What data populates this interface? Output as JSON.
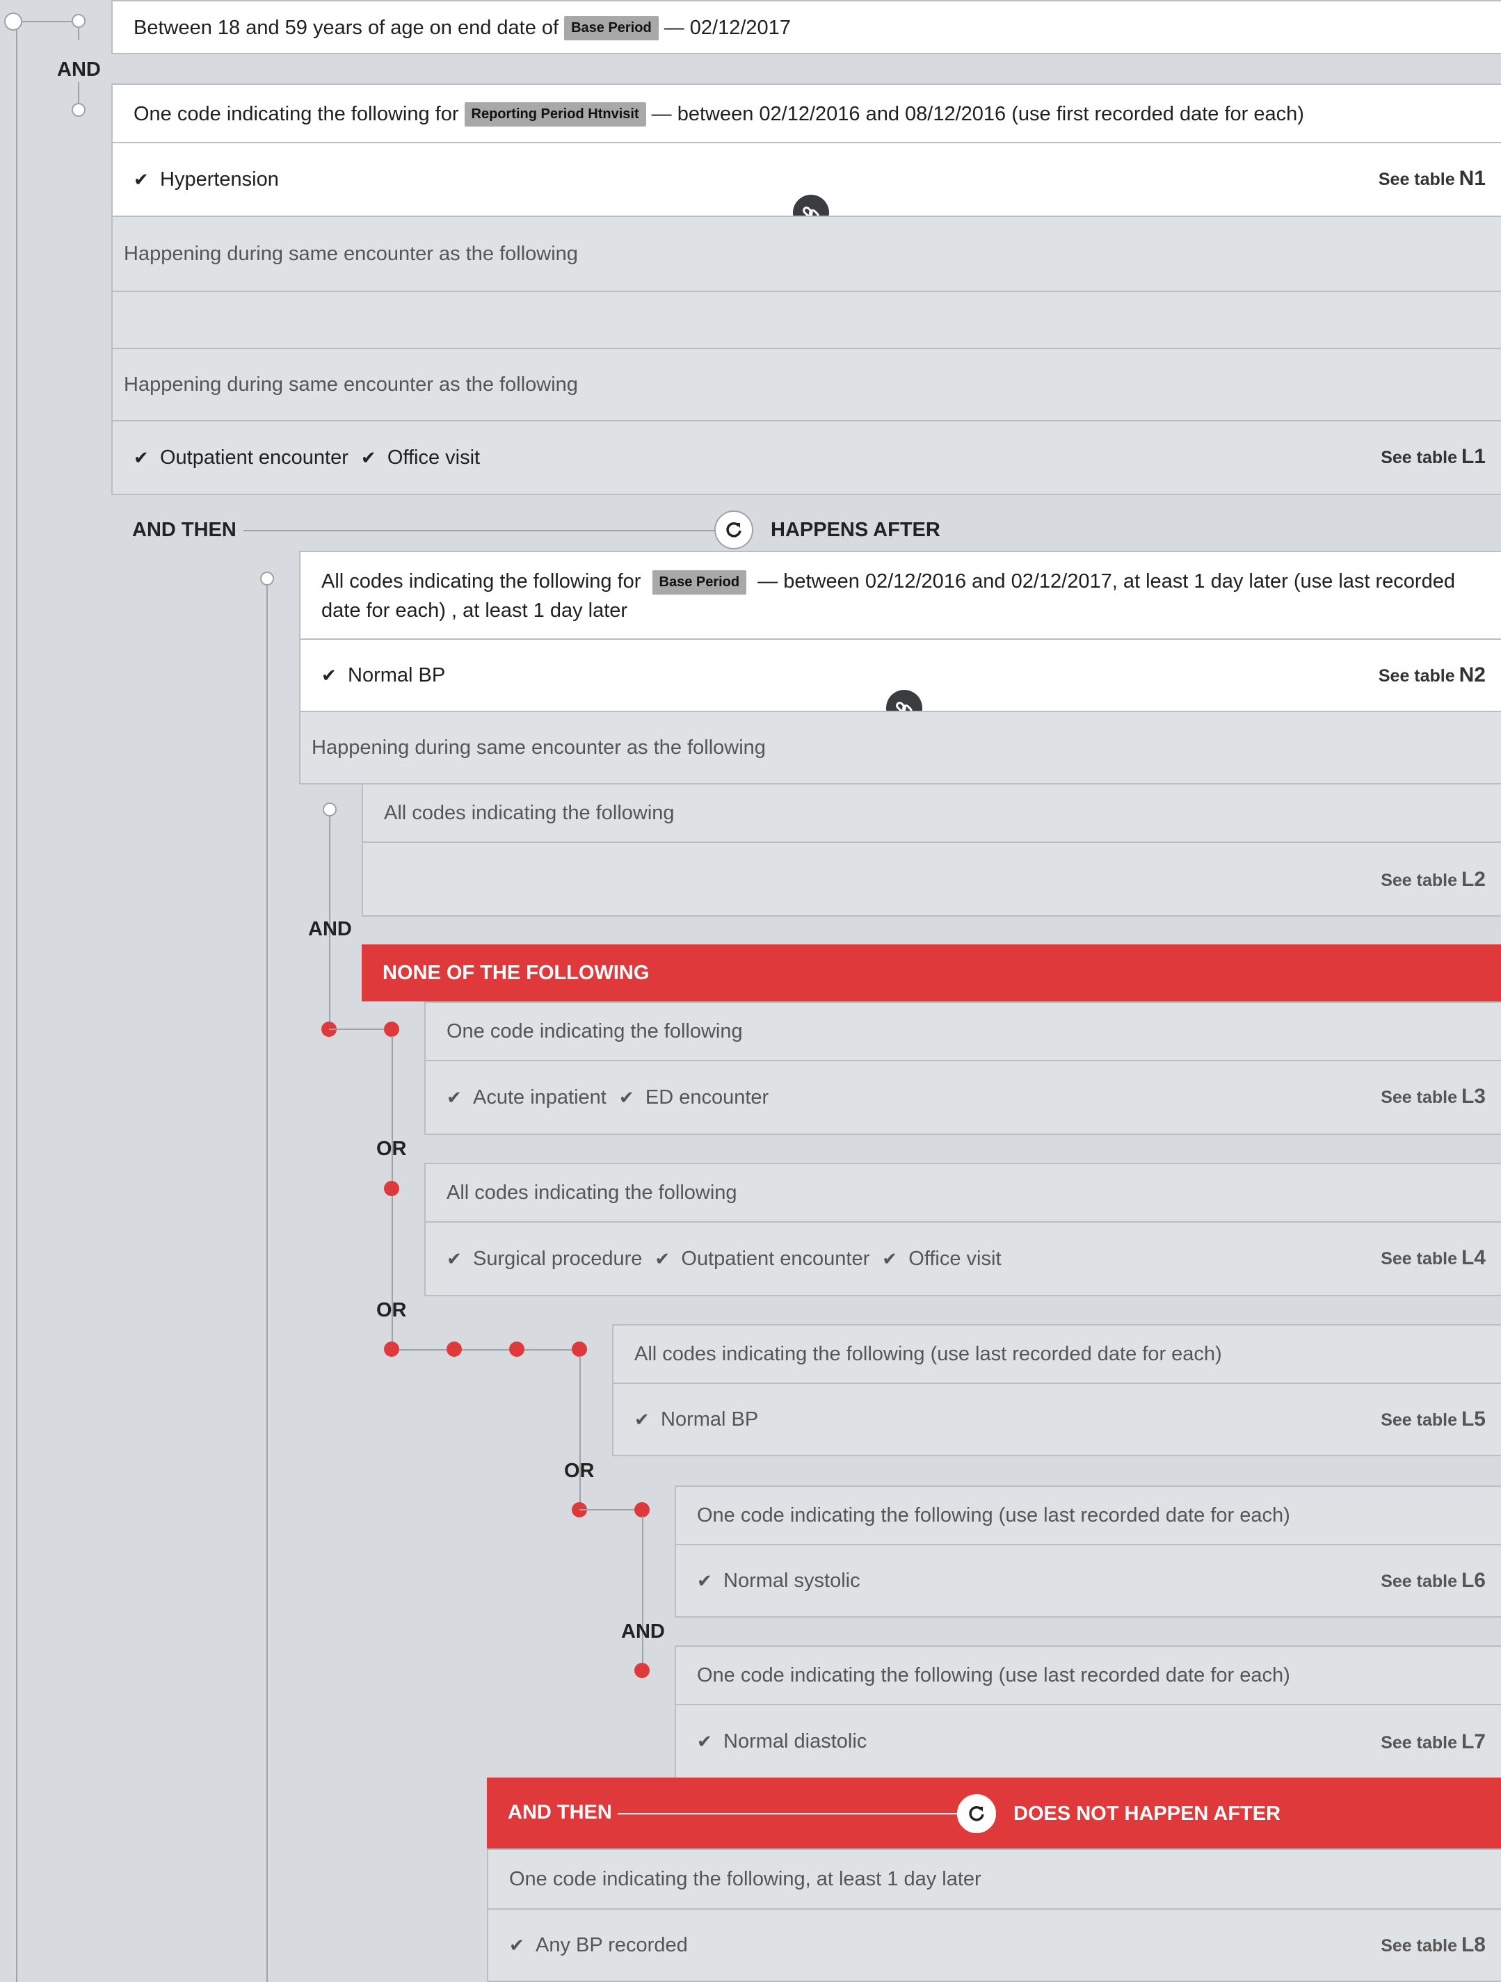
{
  "age": {
    "text": "Between 18 and 59 years of age on end date of",
    "tag": "Base Period",
    "suffix": "— 02/12/2017"
  },
  "and1": "AND",
  "crit1": {
    "prefix": "One code indicating the following for",
    "tag": "Reporting Period Htnvisit",
    "suffix": "— between 02/12/2016 and 08/12/2016 (use first recorded date for each)",
    "items": [
      "Hypertension"
    ],
    "see": "See table",
    "table": "N1",
    "same1": "Happening during same encounter as the following",
    "same2": "Happening during same encounter as the following",
    "items2": [
      "Outpatient encounter",
      "Office visit"
    ],
    "see2": "See table",
    "table2": "L1"
  },
  "and_then": "AND THEN",
  "happens_after": "HAPPENS AFTER",
  "crit2": {
    "prefix": "All codes indicating the following for",
    "tag": "Base Period",
    "suffix": "— between 02/12/2016 and 02/12/2017, at least 1 day later (use last recorded",
    "line2": "date for each) , at least 1 day later",
    "items": [
      "Normal BP"
    ],
    "see": "See table",
    "table": "N2",
    "same": "Happening during same encounter as the following",
    "all_codes": "All codes indicating the following",
    "see_l2": "See table",
    "table_l2": "L2"
  },
  "and2": "AND",
  "none": "NONE OF THE FOLLOWING",
  "l3": {
    "head": "One code indicating the following",
    "items": [
      "Acute inpatient",
      "ED encounter"
    ],
    "see": "See table",
    "table": "L3"
  },
  "or1": "OR",
  "l4": {
    "head": "All codes indicating the following",
    "items": [
      "Surgical procedure",
      "Outpatient encounter",
      "Office visit"
    ],
    "see": "See table",
    "table": "L4"
  },
  "or2": "OR",
  "l5": {
    "head": "All codes indicating the following (use last recorded date for each)",
    "items": [
      "Normal BP"
    ],
    "see": "See table",
    "table": "L5"
  },
  "or3": "OR",
  "l6": {
    "head": "One code indicating the following (use last recorded date for each)",
    "items": [
      "Normal systolic"
    ],
    "see": "See table",
    "table": "L6"
  },
  "and3": "AND",
  "l7": {
    "head": "One code indicating the following (use last recorded date for each)",
    "items": [
      "Normal diastolic"
    ],
    "see": "See table",
    "table": "L7"
  },
  "and_then2": "AND THEN",
  "not_after": "DOES NOT HAPPEN AFTER",
  "l8": {
    "head": "One code indicating the following, at least 1 day later",
    "items": [
      "Any BP recorded"
    ],
    "see": "See table",
    "table": "L8"
  },
  "icons": {
    "check": "check-icon",
    "link": "link-icon",
    "refresh": "refresh-icon"
  },
  "colors": {
    "red": "#e0393b",
    "grey_bg": "#d7dbe0",
    "box_grey": "#dfe2e5"
  }
}
